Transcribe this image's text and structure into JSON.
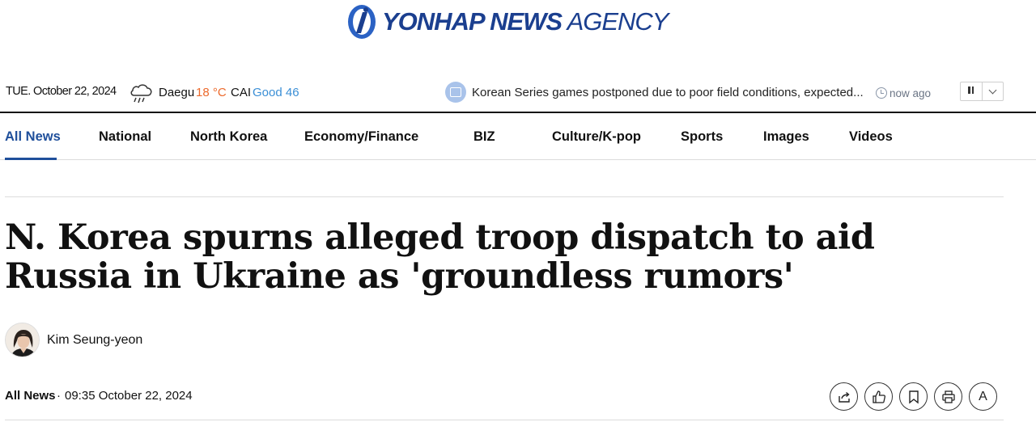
{
  "header": {
    "logo_text_strong": "YONHAP NEWS",
    "logo_text_light": "AGENCY",
    "logo_colors": {
      "primary": "#1b3f8f",
      "accent": "#2b62c4"
    }
  },
  "infobar": {
    "date": "TUE. October 22, 2024",
    "weather_icon": "rain-cloud-icon",
    "city": "Daegu",
    "temperature": "18 °C",
    "cai_label": "CAI",
    "cai_value": "Good 46",
    "ticker_icon": "news-icon",
    "ticker_headline": "Korean Series games postponed due to poor field conditions, expected...",
    "ticker_time": "now ago",
    "controls": {
      "pause": "pause-icon",
      "expand": "chevron-down-icon"
    }
  },
  "nav": {
    "items": [
      {
        "label": "All News",
        "active": true
      },
      {
        "label": "National"
      },
      {
        "label": "North Korea"
      },
      {
        "label": "Economy/Finance"
      },
      {
        "label": "BIZ"
      },
      {
        "label": "Culture/K-pop"
      },
      {
        "label": "Sports"
      },
      {
        "label": "Images"
      },
      {
        "label": "Videos"
      }
    ],
    "active_color": "#1f4f9b"
  },
  "article": {
    "headline": "N. Korea spurns alleged troop dispatch to aid Russia in Ukraine as 'groundless rumors'",
    "author": "Kim Seung-yeon",
    "section": "All News",
    "separator": "·",
    "published": "09:35 October 22, 2024",
    "tools": [
      "share-icon",
      "like-icon",
      "bookmark-icon",
      "print-icon",
      "font-size-icon"
    ],
    "font_tool_label": "A"
  }
}
